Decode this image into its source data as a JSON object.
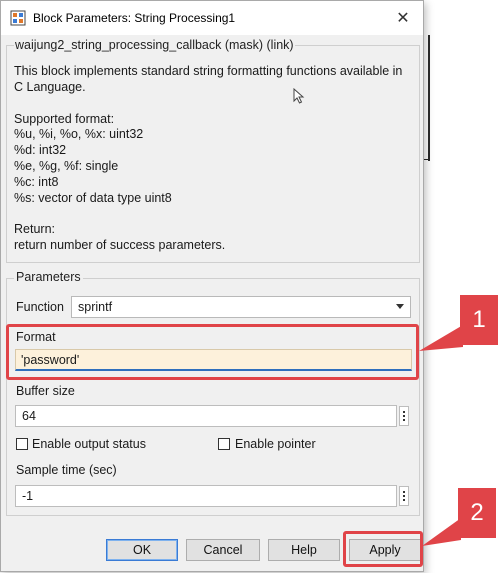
{
  "window": {
    "title": "Block Parameters: String Processing1",
    "close_glyph": "✕"
  },
  "description": {
    "group_title": "waijung2_string_processing_callback (mask) (link)",
    "intro": "This block implements standard string formatting functions available in C Language.",
    "supported_heading": "Supported format:",
    "formats": [
      "%u, %i, %o, %x: uint32",
      "%d: int32",
      "%e, %g, %f: single",
      "%c: int8",
      "%s: vector of data type uint8"
    ],
    "return_heading": "Return:",
    "return_text": "return number of success parameters."
  },
  "parameters": {
    "group_title": "Parameters",
    "function_label": "Function",
    "function_value": "sprintf",
    "format_label": "Format",
    "format_value": "'password'",
    "buffer_label": "Buffer size",
    "buffer_value": "64",
    "enable_output_status_label": "Enable output status",
    "enable_output_status_checked": false,
    "enable_pointer_label": "Enable pointer",
    "enable_pointer_checked": false,
    "sample_time_label": "Sample time (sec)",
    "sample_time_value": "-1"
  },
  "buttons": {
    "ok": "OK",
    "cancel": "Cancel",
    "help": "Help",
    "apply": "Apply"
  },
  "annotations": {
    "callout_1": "1",
    "callout_2": "2",
    "color": "#e04448"
  },
  "icons": [
    "simulink-block-icon",
    "close-icon",
    "dropdown-arrow-icon",
    "kebab-menu-icon",
    "mouse-cursor-icon"
  ]
}
